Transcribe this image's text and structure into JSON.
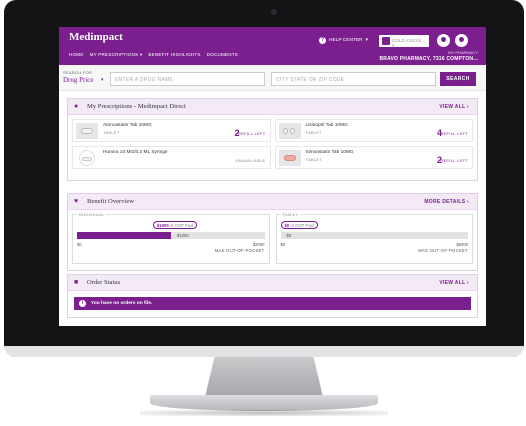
{
  "app": {
    "logo": "Medimpact"
  },
  "nav": {
    "items": [
      "HOME",
      "MY PRESCRIPTIONS",
      "BENEFIT HIGHLIGHTS",
      "DOCUMENTS"
    ]
  },
  "header": {
    "help_label": "HELP CENTER",
    "user_name": "GOLD XXXXX...",
    "pharmacy_label": "MY PHARMACY",
    "pharmacy_name": "BRAVO PHARMACY, 7316 COMPTON..."
  },
  "search": {
    "search_for_label": "SEARCH FOR",
    "selected": "Drug Price",
    "drug_placeholder": "ENTER A DRUG NAME",
    "city_placeholder": "CITY STATE OR ZIP CODE",
    "button_label": "SEARCH"
  },
  "prescriptions": {
    "title": "My Prescriptions - Medimpact Direct",
    "link": "VIEW ALL",
    "items": [
      {
        "name": "Atorvastatin Tab 10MG",
        "form": "TABLET",
        "count": "2",
        "status": "REFILL LEFT"
      },
      {
        "name": "Lisinopril Tab 10MG",
        "form": "TABLET",
        "count": "4",
        "status": "REFILL LEFT"
      },
      {
        "name": "Humira 10 MG/0.2 ML Syringe",
        "form": "",
        "count": "",
        "status": "UNAVAILABLE"
      },
      {
        "name": "Simvastatin Tab 10MG",
        "form": "TABLET",
        "count": "2",
        "status": "REFILL LEFT"
      }
    ]
  },
  "benefit": {
    "title": "Benefit Overview",
    "link": "MORE DETAILS",
    "individual": {
      "label": "INDIVIDUAL",
      "bubble_amount": "$1000",
      "bubble_text": "of OOP Paid",
      "fill_label": "$1000",
      "fill_fraction": 0.5,
      "min": "$0",
      "max": "$2000",
      "cap_label": "MAX OUT-OF-POCKET"
    },
    "family": {
      "label": "FAMILY",
      "bubble_amount": "$0",
      "bubble_text": "of OOP Paid",
      "fill_label": "$0",
      "fill_fraction": 0,
      "min": "$0",
      "max": "$6000",
      "cap_label": "MAX OUT-OF-POCKET"
    }
  },
  "orders": {
    "title": "Order Status",
    "link": "VIEW ALL",
    "message": "You have no orders on file."
  },
  "colors": {
    "accent": "#7b1f8f"
  }
}
